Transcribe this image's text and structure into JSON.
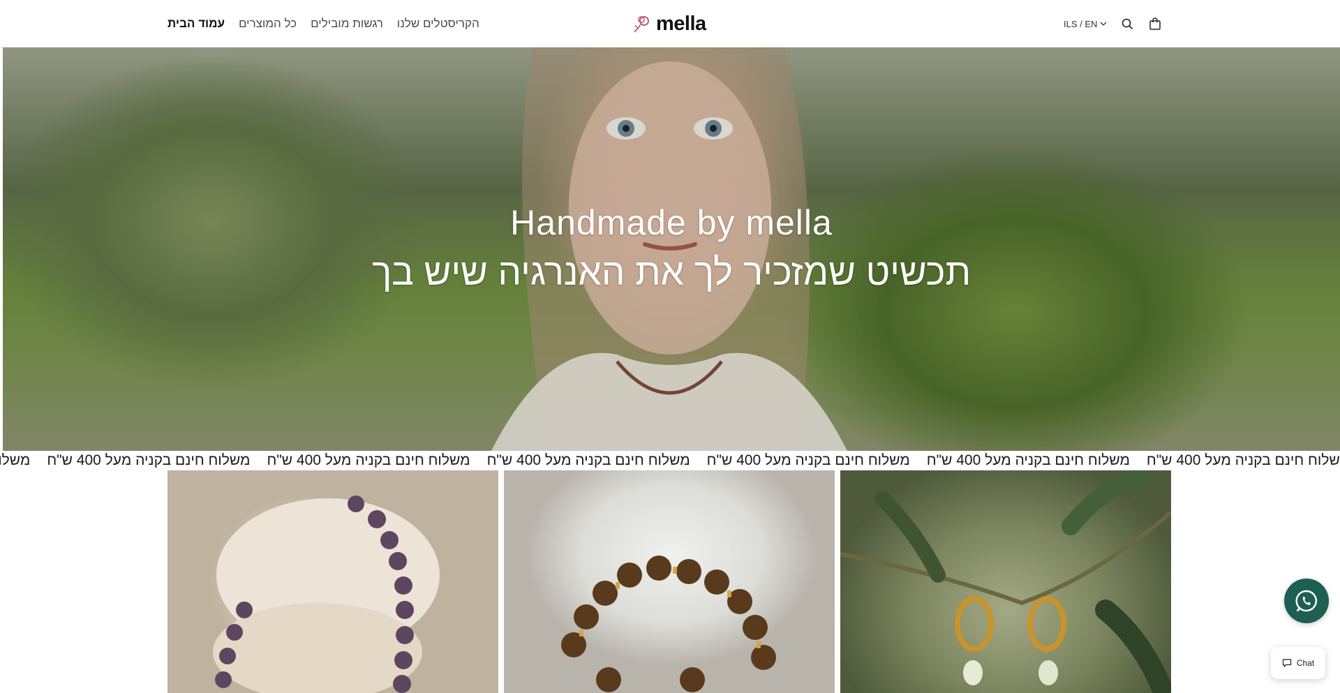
{
  "header": {
    "nav": [
      {
        "label": "עמוד הבית",
        "active": true
      },
      {
        "label": "כל המוצרים",
        "active": false
      },
      {
        "label": "רגשות מובילים",
        "active": false
      },
      {
        "label": "הקריסטלים שלנו",
        "active": false
      }
    ],
    "logo_text": "mella",
    "locale": "ILS / EN",
    "icons": [
      "search-icon",
      "bag-icon"
    ]
  },
  "hero": {
    "title": "Handmade by mella",
    "subtitle": "תכשיט שמזכיר לך את האנרגיה שיש בך"
  },
  "marquee": {
    "text": "משלוח חינם בקניה מעל 400 ש\"ח"
  },
  "products": [
    {
      "name": "amethyst-bracelet"
    },
    {
      "name": "tiger-eye-bracelet"
    },
    {
      "name": "gold-hoop-earrings"
    }
  ],
  "floating": {
    "chat_label": "Chat",
    "whatsapp_color": "#1d5f52"
  }
}
